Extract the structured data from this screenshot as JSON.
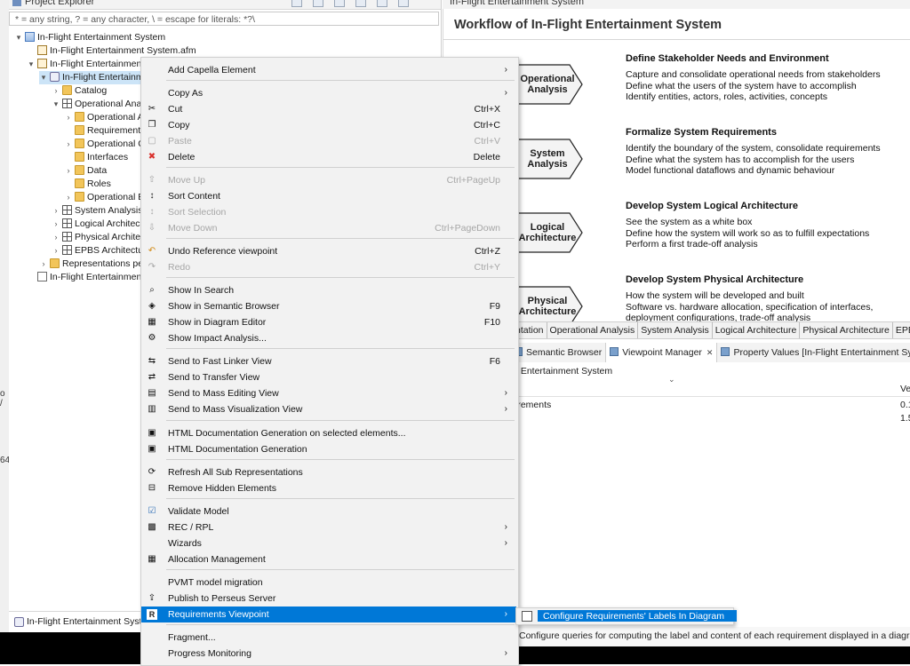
{
  "explorer": {
    "tab_label": "Project Explorer",
    "filter_placeholder": "* = any string, ? = any character, \\ = escape for literals: *?\\",
    "tree": [
      {
        "label": "In-Flight Entertainment System"
      },
      {
        "label": "In-Flight Entertainment System.afm"
      },
      {
        "label": "In-Flight Entertainmen"
      },
      {
        "label": "In-Flight Entertainm"
      },
      {
        "label": "Catalog"
      },
      {
        "label": "Operational Ana"
      },
      {
        "label": "Operational A"
      },
      {
        "label": "Requirements"
      },
      {
        "label": "Operational C"
      },
      {
        "label": "Interfaces"
      },
      {
        "label": "Data"
      },
      {
        "label": "Roles"
      },
      {
        "label": "Operational E"
      },
      {
        "label": "System Analysis"
      },
      {
        "label": "Logical Architec"
      },
      {
        "label": "Physical Archite"
      },
      {
        "label": "EPBS Architectu"
      },
      {
        "label": "Representations pe"
      },
      {
        "label": "In-Flight Entertainmen"
      }
    ],
    "footer_label": "In-Flight Entertainment Syste",
    "left_edge": [
      "o /",
      "64"
    ]
  },
  "editor": {
    "tab_label": "In-Flight Entertainment System",
    "title": "Workflow of In-Flight Entertainment System",
    "steps": [
      {
        "label_lines": [
          "Operational",
          "Analysis"
        ],
        "heading": "Define Stakeholder Needs and Environment",
        "lines": [
          "Capture and consolidate operational needs from stakeholders",
          "Define what the users of the system have to accomplish",
          "Identify entities, actors, roles, activities, concepts"
        ]
      },
      {
        "label_lines": [
          "System",
          "Analysis"
        ],
        "heading": "Formalize System Requirements",
        "lines": [
          "Identify the boundary of the system, consolidate requirements",
          "Define what the system has to accomplish for the users",
          "Model functional dataflows and dynamic behaviour"
        ]
      },
      {
        "label_lines": [
          "Logical",
          "Architecture"
        ],
        "heading": "Develop System Logical Architecture",
        "lines": [
          "See the system as a white box",
          "Define how the system will work so as to fulfill expectations",
          "Perform a first trade-off analysis"
        ]
      },
      {
        "label_lines": [
          "Physical",
          "Architecture"
        ],
        "heading": "Develop System Physical Architecture",
        "lines": [
          "How the system will be developed and built",
          "Software vs. hardware allocation, specification of interfaces,",
          "deployment configurations, trade-off analysis"
        ]
      }
    ],
    "layer_tabs": [
      "ntation",
      "Operational Analysis",
      "System Analysis",
      "Logical Architecture",
      "Physical Architecture",
      "EPBS"
    ]
  },
  "views": {
    "tabs": [
      {
        "label": "Semantic Browser"
      },
      {
        "label": "Viewpoint Manager"
      },
      {
        "label": "Property Values [In-Flight Entertainment Syste"
      }
    ],
    "body_title": "t Entertainment System",
    "col_header": "Ve",
    "row_label": "irements",
    "values": [
      "0.1",
      "1.5"
    ],
    "status_description": "Configure queries for computing the label and content of each requirement displayed in a diagram"
  },
  "context_menu": {
    "items": [
      {
        "label": "Add Capella Element",
        "submenu": true
      },
      {
        "label": "Copy As",
        "submenu": true
      },
      {
        "label": "Cut",
        "shortcut": "Ctrl+X",
        "icon": "cut-icon"
      },
      {
        "label": "Copy",
        "shortcut": "Ctrl+C",
        "icon": "copy-icon"
      },
      {
        "label": "Paste",
        "shortcut": "Ctrl+V",
        "disabled": true,
        "icon": "paste-icon"
      },
      {
        "label": "Delete",
        "shortcut": "Delete",
        "icon": "delete-icon"
      },
      {
        "label": "Move Up",
        "shortcut": "Ctrl+PageUp",
        "disabled": true,
        "icon": "move-up-icon"
      },
      {
        "label": "Sort Content",
        "icon": "sort-icon"
      },
      {
        "label": "Sort Selection",
        "disabled": true,
        "icon": "sort-selection-icon"
      },
      {
        "label": "Move Down",
        "shortcut": "Ctrl+PageDown",
        "disabled": true,
        "icon": "move-down-icon"
      },
      {
        "label": "Undo Reference viewpoint",
        "shortcut": "Ctrl+Z",
        "icon": "undo-icon"
      },
      {
        "label": "Redo",
        "shortcut": "Ctrl+Y",
        "disabled": true,
        "icon": "redo-icon"
      },
      {
        "label": "Show In Search",
        "icon": "search-icon"
      },
      {
        "label": "Show in Semantic Browser",
        "shortcut": "F9",
        "icon": "semantic-browser-icon"
      },
      {
        "label": "Show in Diagram Editor",
        "shortcut": "F10",
        "icon": "diagram-icon"
      },
      {
        "label": "Show Impact Analysis...",
        "icon": "impact-icon"
      },
      {
        "label": "Send to Fast Linker View",
        "shortcut": "F6",
        "icon": "linker-icon"
      },
      {
        "label": "Send to Transfer View",
        "icon": "transfer-icon"
      },
      {
        "label": "Send to Mass Editing View",
        "submenu": true,
        "icon": "mass-edit-icon"
      },
      {
        "label": "Send to Mass Visualization View",
        "submenu": true,
        "icon": "mass-visual-icon"
      },
      {
        "label": "HTML Documentation Generation on selected elements...",
        "icon": "html-doc-icon"
      },
      {
        "label": "HTML Documentation Generation",
        "icon": "html-doc-icon"
      },
      {
        "label": "Refresh All Sub Representations",
        "icon": "refresh-icon"
      },
      {
        "label": "Remove Hidden Elements",
        "icon": "remove-hidden-icon"
      },
      {
        "label": "Validate Model",
        "icon": "validate-icon"
      },
      {
        "label": "REC / RPL",
        "submenu": true,
        "icon": "rec-rpl-icon"
      },
      {
        "label": "Wizards",
        "submenu": true
      },
      {
        "label": "Allocation Management",
        "icon": "allocation-icon"
      },
      {
        "label": "PVMT model migration"
      },
      {
        "label": "Publish to Perseus Server",
        "icon": "publish-icon"
      },
      {
        "label": "Requirements Viewpoint",
        "submenu": true,
        "highlighted": true,
        "icon": "requirements-icon"
      },
      {
        "label": "Fragment..."
      },
      {
        "label": "Progress Monitoring",
        "submenu": true
      }
    ],
    "submenu_item": "Configure Requirements' Labels In Diagram"
  },
  "colors": {
    "highlight": "#0078d7",
    "menu_bg": "#f2f2f2",
    "disabled_text": "#a6a6a6"
  }
}
